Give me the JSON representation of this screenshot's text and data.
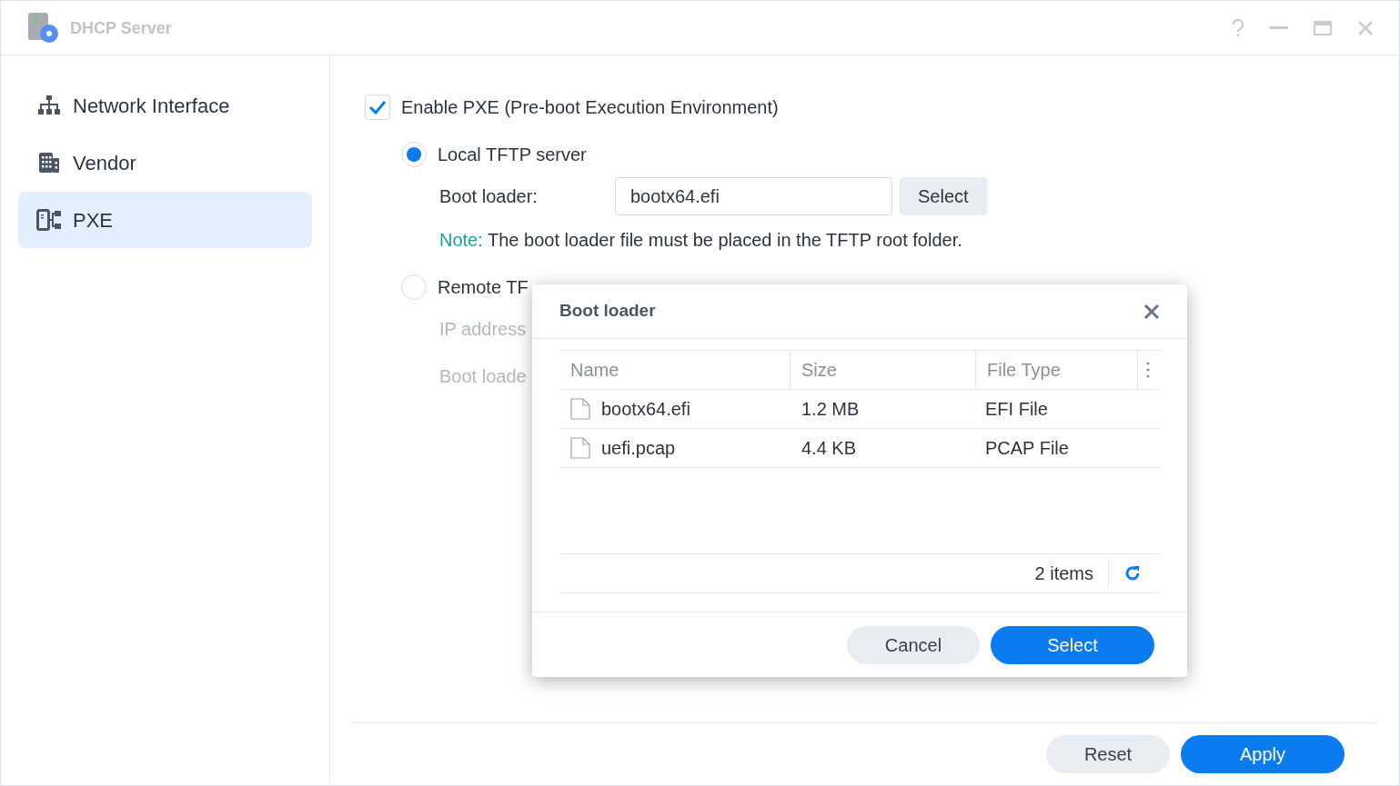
{
  "window": {
    "title": "DHCP Server"
  },
  "sidebar": {
    "items": [
      {
        "label": "Network Interface",
        "kind": "network",
        "selected": false
      },
      {
        "label": "Vendor",
        "kind": "vendor",
        "selected": false
      },
      {
        "label": "PXE",
        "kind": "pxe",
        "selected": true
      }
    ]
  },
  "pxe": {
    "enable": {
      "label": "Enable PXE (Pre-boot Execution Environment)",
      "checked": true
    },
    "options": [
      {
        "label": "Local TFTP server",
        "selected": true,
        "fields": [
          {
            "label": "Boot loader:",
            "value": "bootx64.efi",
            "button": "Select",
            "disabled": false
          }
        ],
        "note": {
          "prefix": "Note:",
          "text": "The boot loader file must be placed in the TFTP root folder."
        }
      },
      {
        "label": "Remote TF",
        "selected": false,
        "fields": [
          {
            "label": "IP address",
            "disabled": true
          },
          {
            "label": "Boot loade",
            "disabled": true
          }
        ]
      }
    ]
  },
  "footer": {
    "buttons": [
      {
        "label": "Reset",
        "kind": "secondary"
      },
      {
        "label": "Apply",
        "kind": "primary"
      }
    ]
  },
  "dialog": {
    "title": "Boot loader",
    "table": {
      "columns": [
        "Name",
        "Size",
        "File Type"
      ],
      "rows": [
        {
          "name": "bootx64.efi",
          "size": "1.2 MB",
          "type": "EFI File"
        },
        {
          "name": "uefi.pcap",
          "size": "4.4 KB",
          "type": "PCAP File"
        }
      ]
    },
    "count": "2 items",
    "buttons": [
      {
        "label": "Cancel",
        "kind": "secondary"
      },
      {
        "label": "Select",
        "kind": "primary"
      }
    ]
  }
}
